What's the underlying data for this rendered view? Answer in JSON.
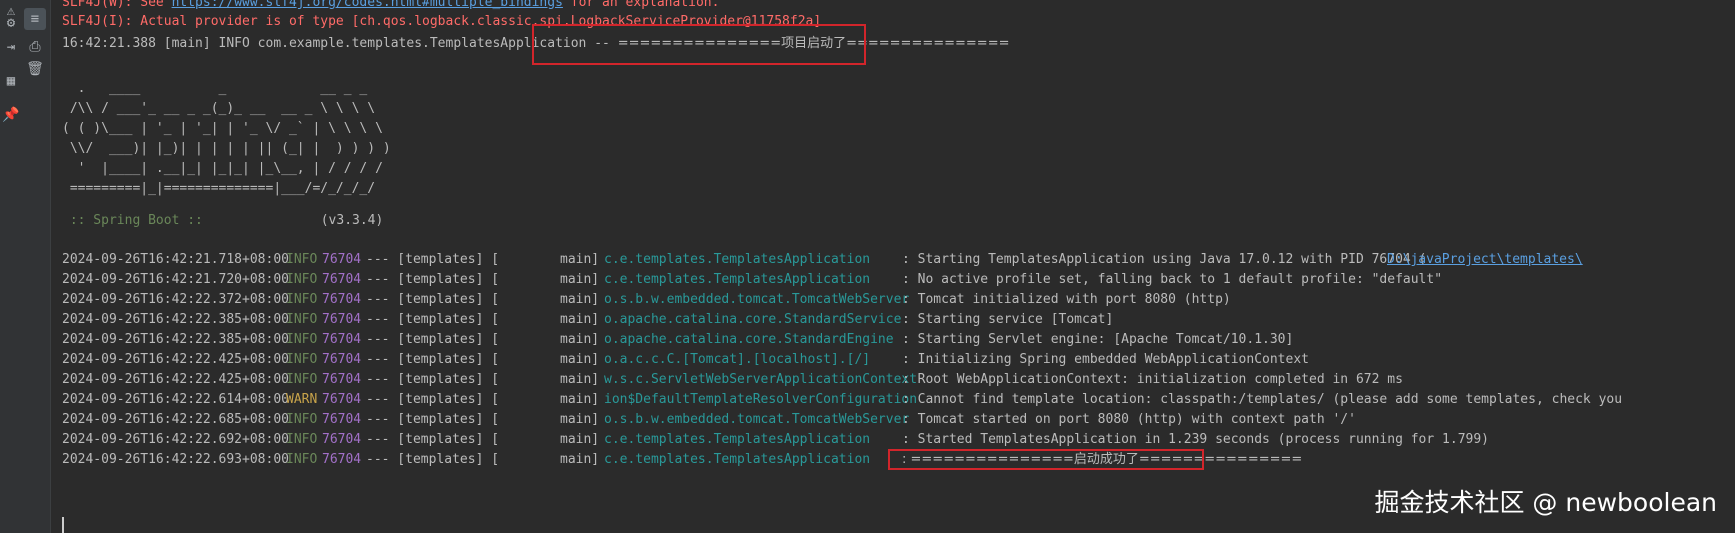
{
  "gutter": {
    "icons": [
      "warning-icon",
      "soft-wrap-icon",
      "settings-icon",
      "print-icon",
      "exit-icon",
      "clear-icon",
      "layout-icon",
      "pin-icon"
    ]
  },
  "preamble": {
    "line1_prefix": "SLF4J(W): See ",
    "line1_link": "https://www.slf4j.org/codes.html#multiple_bindings",
    "line1_suffix": " for an explanation.",
    "line2": "SLF4J(I): Actual provider is of type [ch.qos.logback.classic.spi.LogbackServiceProvider@11758f2a]",
    "line3_prefix": "16:42:21.388 [main] INFO com.example.templates.TemplatesApplication -- ",
    "line3_msg": "===============项目启动了==============="
  },
  "banner": [
    "  .   ____          _            __ _ _",
    " /\\\\ / ___'_ __ _ _(_)_ __  __ _ \\ \\ \\ \\",
    "( ( )\\___ | '_ | '_| | '_ \\/ _` | \\ \\ \\ \\",
    " \\\\/  ___)| |_)| | | | | || (_| |  ) ) ) )",
    "  '  |____| .__|_| |_|_| |_\\__, | / / / /",
    " =========|_|==============|___/=/_/_/_/"
  ],
  "spring": {
    "label": " :: Spring Boot :: ",
    "version": "(v3.3.4)"
  },
  "logs": [
    {
      "ts": "2024-09-26T16:42:21.718+08:00",
      "level": "INFO",
      "pid": "76704",
      "app": "--- [templates] [",
      "thread": "main]",
      "logger": "c.e.templates.TemplatesApplication",
      "msg": ": Starting TemplatesApplication using Java 17.0.12 with PID 76704 (",
      "link": "D:\\javaProject\\templates\\"
    },
    {
      "ts": "2024-09-26T16:42:21.720+08:00",
      "level": "INFO",
      "pid": "76704",
      "app": "--- [templates] [",
      "thread": "main]",
      "logger": "c.e.templates.TemplatesApplication",
      "msg": ": No active profile set, falling back to 1 default profile: \"default\"",
      "link": ""
    },
    {
      "ts": "2024-09-26T16:42:22.372+08:00",
      "level": "INFO",
      "pid": "76704",
      "app": "--- [templates] [",
      "thread": "main]",
      "logger": "o.s.b.w.embedded.tomcat.TomcatWebServer",
      "msg": ": Tomcat initialized with port 8080 (http)",
      "link": ""
    },
    {
      "ts": "2024-09-26T16:42:22.385+08:00",
      "level": "INFO",
      "pid": "76704",
      "app": "--- [templates] [",
      "thread": "main]",
      "logger": "o.apache.catalina.core.StandardService",
      "msg": ": Starting service [Tomcat]",
      "link": ""
    },
    {
      "ts": "2024-09-26T16:42:22.385+08:00",
      "level": "INFO",
      "pid": "76704",
      "app": "--- [templates] [",
      "thread": "main]",
      "logger": "o.apache.catalina.core.StandardEngine",
      "msg": ": Starting Servlet engine: [Apache Tomcat/10.1.30]",
      "link": ""
    },
    {
      "ts": "2024-09-26T16:42:22.425+08:00",
      "level": "INFO",
      "pid": "76704",
      "app": "--- [templates] [",
      "thread": "main]",
      "logger": "o.a.c.c.C.[Tomcat].[localhost].[/]",
      "msg": ": Initializing Spring embedded WebApplicationContext",
      "link": ""
    },
    {
      "ts": "2024-09-26T16:42:22.425+08:00",
      "level": "INFO",
      "pid": "76704",
      "app": "--- [templates] [",
      "thread": "main]",
      "logger": "w.s.c.ServletWebServerApplicationContext",
      "msg": ": Root WebApplicationContext: initialization completed in 672 ms",
      "link": ""
    },
    {
      "ts": "2024-09-26T16:42:22.614+08:00",
      "level": "WARN",
      "pid": "76704",
      "app": "--- [templates] [",
      "thread": "main]",
      "logger": "ion$DefaultTemplateResolverConfiguration",
      "msg": ": Cannot find template location: classpath:/templates/ (please add some templates, check you",
      "link": ""
    },
    {
      "ts": "2024-09-26T16:42:22.685+08:00",
      "level": "INFO",
      "pid": "76704",
      "app": "--- [templates] [",
      "thread": "main]",
      "logger": "o.s.b.w.embedded.tomcat.TomcatWebServer",
      "msg": ": Tomcat started on port 8080 (http) with context path '/'",
      "link": ""
    },
    {
      "ts": "2024-09-26T16:42:22.692+08:00",
      "level": "INFO",
      "pid": "76704",
      "app": "--- [templates] [",
      "thread": "main]",
      "logger": "c.e.templates.TemplatesApplication",
      "msg": ": Started TemplatesApplication in 1.239 seconds (process running for 1.799)",
      "link": ""
    },
    {
      "ts": "2024-09-26T16:42:22.693+08:00",
      "level": "INFO",
      "pid": "76704",
      "app": "--- [templates] [",
      "thread": "main]",
      "logger": "c.e.templates.TemplatesApplication",
      "msg": ": ===============启动成功了===============",
      "link": ""
    }
  ],
  "watermark": "掘金技术社区 @ newboolean"
}
